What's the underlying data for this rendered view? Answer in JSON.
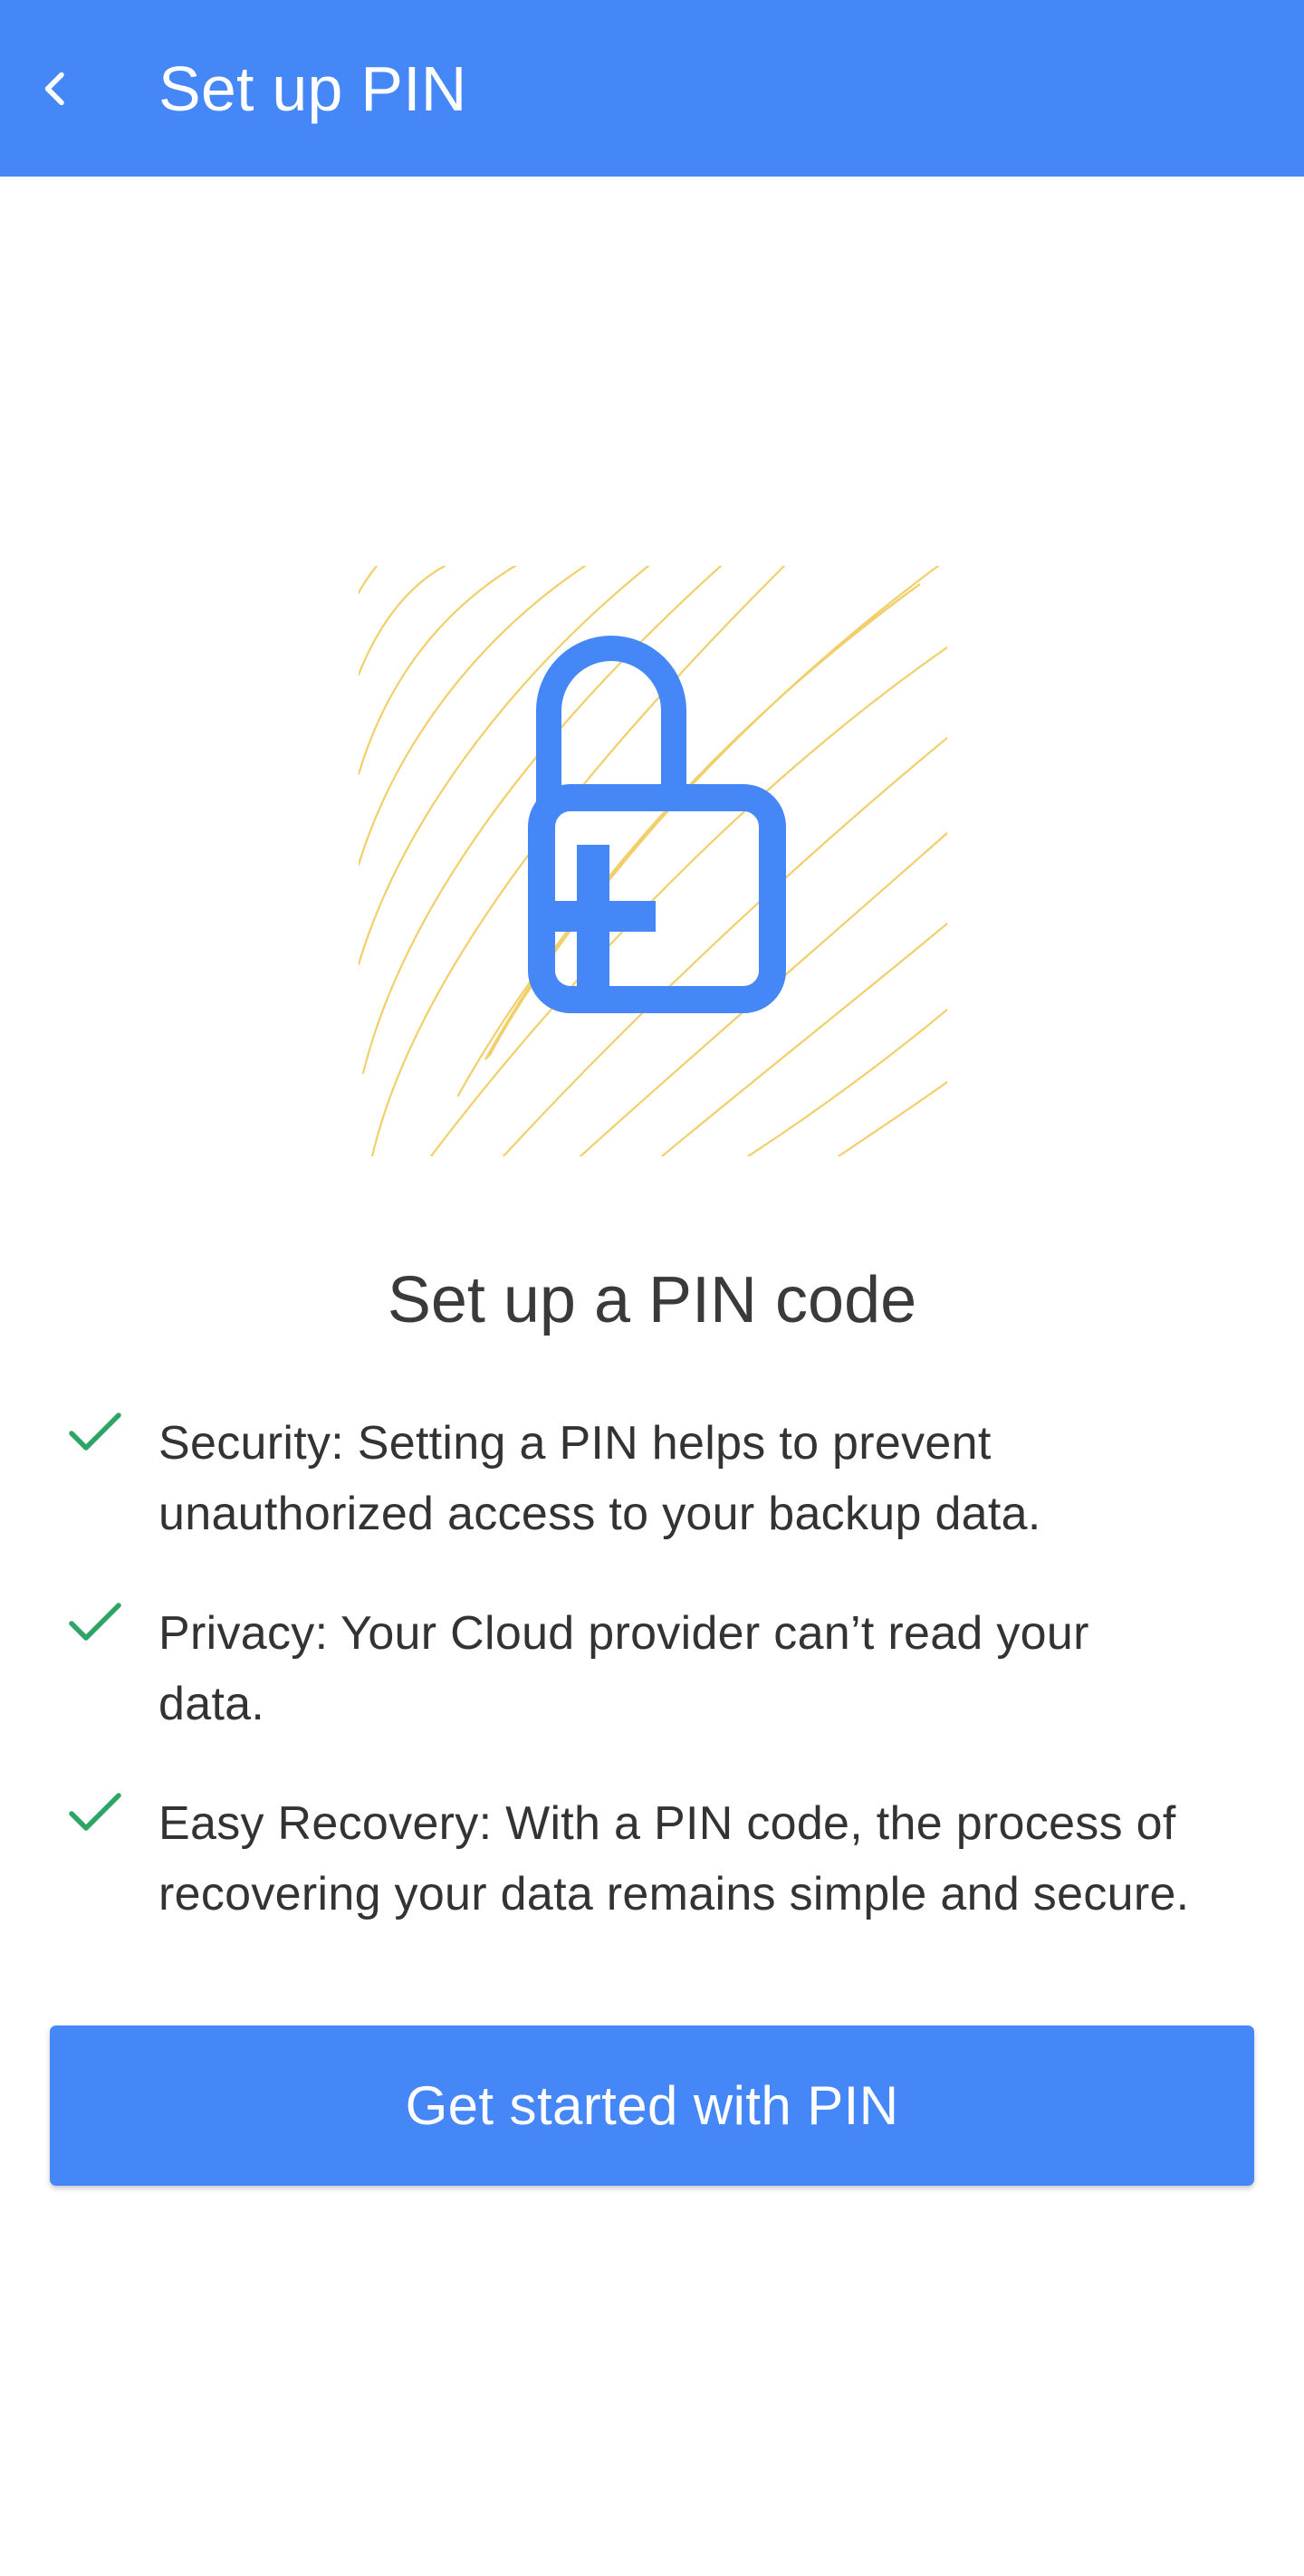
{
  "app_bar": {
    "title": "Set up PIN",
    "back_icon": "chevron-left-icon",
    "background_color": "#4587f7"
  },
  "hero": {
    "icon": "lock-plus-icon",
    "background_pattern": "contour-lines",
    "icon_color": "#4587f7",
    "pattern_color": "#f1cf6a"
  },
  "heading": "Set up a PIN code",
  "benefits": [
    {
      "icon": "check-icon",
      "line1": "Security: Setting a PIN helps to prevent",
      "line2": "unauthorized access to your backup data."
    },
    {
      "icon": "check-icon",
      "line1": "Privacy: Your Cloud provider can’t read your",
      "line2": "data."
    },
    {
      "icon": "check-icon",
      "line1": "Easy Recovery: With a PIN code, the process of",
      "line2": "recovering your data remains simple and secure."
    }
  ],
  "check_color": "#2ea566",
  "cta": {
    "label": "Get started with PIN",
    "background_color": "#4587f7"
  }
}
